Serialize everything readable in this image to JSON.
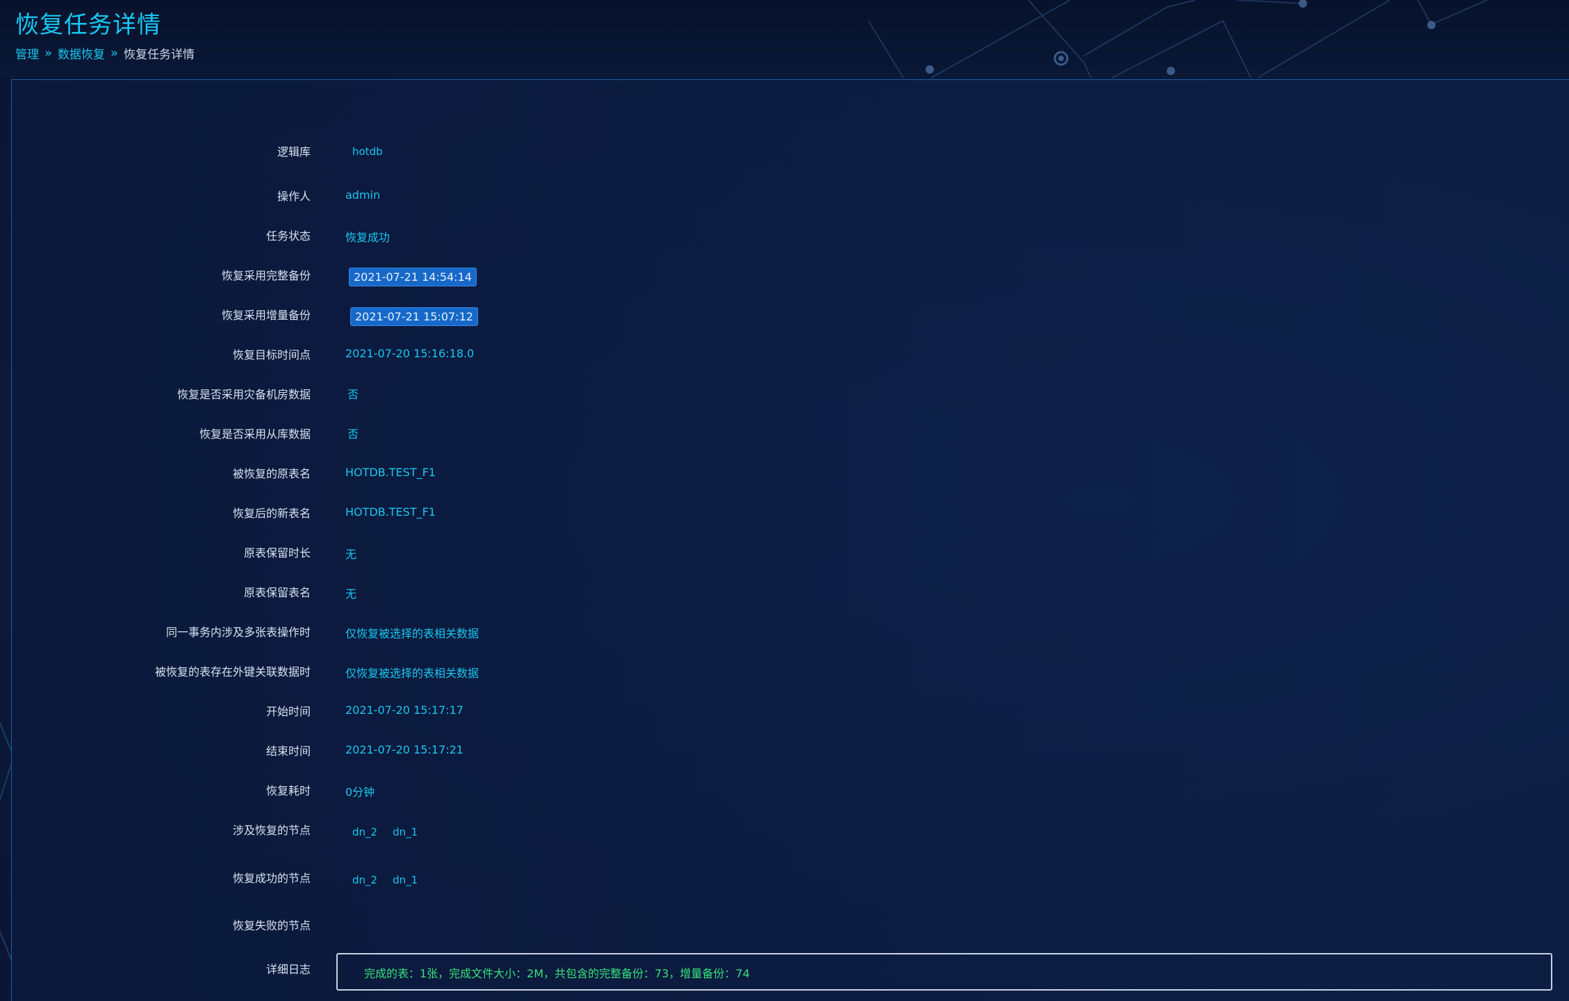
{
  "header": {
    "title": "恢复任务详情",
    "breadcrumb": [
      "管理",
      "数据恢复",
      "恢复任务详情"
    ],
    "separator": "»"
  },
  "details": {
    "logic_db": {
      "label": "逻辑库",
      "value": "hotdb"
    },
    "operator": {
      "label": "操作人",
      "value": "admin"
    },
    "task_status": {
      "label": "任务状态",
      "value": "恢复成功"
    },
    "full_backup": {
      "label": "恢复采用完整备份",
      "value": "2021-07-21 14:54:14"
    },
    "incr_backup": {
      "label": "恢复采用增量备份",
      "value": "2021-07-21 15:07:12"
    },
    "target_time": {
      "label": "恢复目标时间点",
      "value": "2021-07-20 15:16:18.0"
    },
    "use_dr_data": {
      "label": "恢复是否采用灾备机房数据",
      "value": "否"
    },
    "use_slave_data": {
      "label": "恢复是否采用从库数据",
      "value": "否"
    },
    "orig_table": {
      "label": "被恢复的原表名",
      "value": "HOTDB.TEST_F1"
    },
    "new_table": {
      "label": "恢复后的新表名",
      "value": "HOTDB.TEST_F1"
    },
    "keep_duration": {
      "label": "原表保留时长",
      "value": "无"
    },
    "keep_name": {
      "label": "原表保留表名",
      "value": "无"
    },
    "multi_table_txn": {
      "label": "同一事务内涉及多张表操作时",
      "value": "仅恢复被选择的表相关数据"
    },
    "fk_related": {
      "label": "被恢复的表存在外键关联数据时",
      "value": "仅恢复被选择的表相关数据"
    },
    "start_time": {
      "label": "开始时间",
      "value": "2021-07-20 15:17:17"
    },
    "end_time": {
      "label": "结束时间",
      "value": "2021-07-20 15:17:21"
    },
    "duration": {
      "label": "恢复耗时",
      "value": "0分钟"
    },
    "involved_nodes": {
      "label": "涉及恢复的节点",
      "nodes": [
        "dn_2",
        "dn_1"
      ]
    },
    "success_nodes": {
      "label": "恢复成功的节点",
      "nodes": [
        "dn_2",
        "dn_1"
      ]
    },
    "failed_nodes": {
      "label": "恢复失败的节点",
      "nodes": []
    },
    "log": {
      "label": "详细日志",
      "value": "完成的表：1张，完成文件大小：2M，共包含的完整备份：73，增量备份：74"
    }
  },
  "colors": {
    "accent": "#19c7f0",
    "chip": "#1769c9",
    "log_text": "#38e07a",
    "background": "#0b1838"
  }
}
